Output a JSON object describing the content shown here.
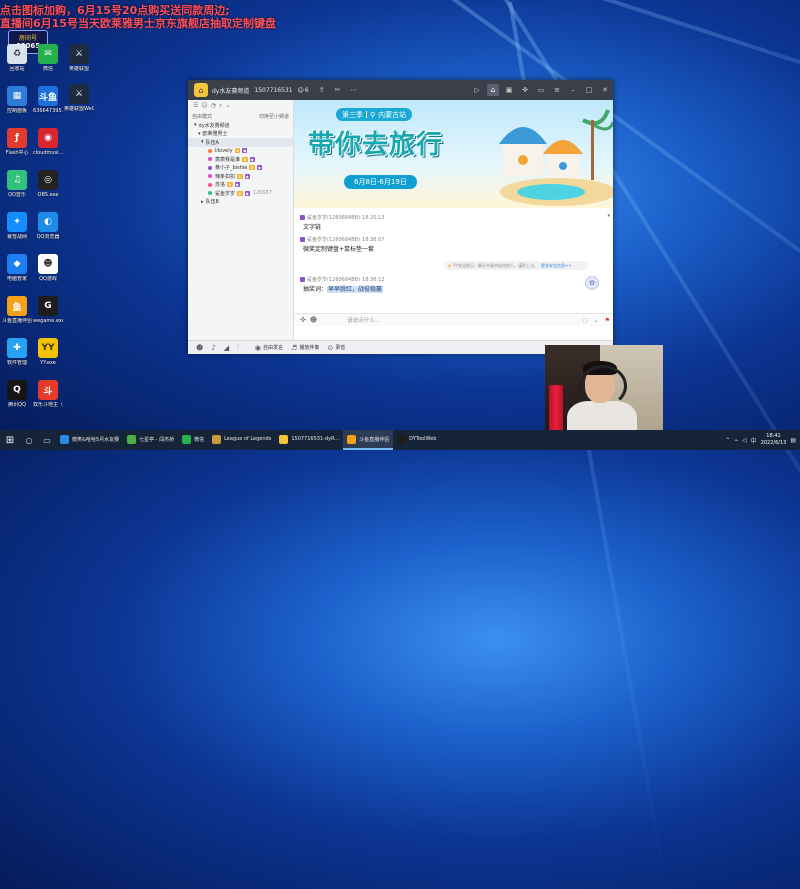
{
  "overlay": {
    "line1": "点击图标加购，6月15号20点购买送同款周边;",
    "line2": "直播间6月15号当天欧莱雅男士京东旗舰店抽取定制键盘",
    "brand_badge": "房间号",
    "room_no": "60065"
  },
  "desktop": {
    "col1": [
      {
        "label": "回收站",
        "color": "#d9e3ee",
        "glyph": "♻"
      },
      {
        "label": "控制面板",
        "color": "#2f7bd6",
        "glyph": "▦"
      },
      {
        "label": "Flash中心",
        "color": "#e23b2e",
        "glyph": "ƒ"
      },
      {
        "label": "QQ音乐",
        "color": "#31c27c",
        "glyph": "♫"
      },
      {
        "label": "暴雪战网",
        "color": "#148eff",
        "glyph": "✦"
      },
      {
        "label": "电脑管家",
        "color": "#1d7ff0",
        "glyph": "◆"
      },
      {
        "label": "斗鱼直播伴侣",
        "color": "#f4a118",
        "glyph": "鱼"
      },
      {
        "label": "软件管理",
        "color": "#26a3f2",
        "glyph": "✚"
      },
      {
        "label": "腾讯QQ",
        "color": "#151515",
        "glyph": "Q"
      }
    ],
    "col2": [
      {
        "label": "微信",
        "color": "#26b04e",
        "glyph": "✉"
      },
      {
        "label": "636647395...",
        "color": "#1e6fd9",
        "glyph": "斗鱼"
      },
      {
        "label": "cloudmusi...",
        "color": "#d8262f",
        "glyph": "◉"
      },
      {
        "label": "OBS.exe",
        "color": "#222222",
        "glyph": "◎"
      },
      {
        "label": "QQ浏览器",
        "color": "#1d8be8",
        "glyph": "◐"
      },
      {
        "label": "QQ游戏",
        "color": "#ffffff",
        "glyph": "☻"
      },
      {
        "label": "wegame.exe",
        "color": "#1d1d1d",
        "glyph": "G"
      },
      {
        "label": "YY.exe",
        "color": "#f5c400",
        "glyph": "YY"
      },
      {
        "label": "双乐斗地主（手游电脑版）",
        "color": "#e33c2c",
        "glyph": "斗"
      }
    ],
    "col3": [
      {
        "label": "英雄联盟",
        "color": "#1c2b3f",
        "glyph": "⚔"
      },
      {
        "label": "英雄联盟WeGame版",
        "color": "#1c2b3f",
        "glyph": "⚔"
      }
    ]
  },
  "window": {
    "title": "dy水友赛频道",
    "channel_id": "1507716531",
    "user_count": "6",
    "left_panel": {
      "mode_label": "自由模式",
      "switch_label": "切换至小频道",
      "channel": "dy水友赛频道",
      "group": "欧莱雅男士",
      "subgroup": "队伍A",
      "members": [
        {
          "name": "lilovely",
          "color": "#ff7c2a"
        },
        {
          "name": "萧萧我是谁",
          "color": "#d94fc0"
        },
        {
          "name": "黄小子_bishie",
          "color": "#8a53c6"
        },
        {
          "name": "辣条扣扣",
          "color": "#d94fc0"
        },
        {
          "name": "苏洛",
          "color": "#ff4c8c"
        },
        {
          "name": "鲨鱼岁岁",
          "color": "#2ac07a",
          "extra": "126687"
        }
      ],
      "other_group": "队伍B"
    },
    "banner": {
      "season": "第三季",
      "location": "内蒙古站",
      "title": "带你去旅行",
      "dates": "6月8日-6月19日"
    },
    "messages": [
      {
        "user": "鲨鱼岁岁(1260684BB)",
        "time": "18:20:13",
        "text": "文字链"
      },
      {
        "user": "鲨鱼岁岁(1260684BB)",
        "time": "18:36:07",
        "text": "微笑定制键盘+鼠标垫一套"
      },
      {
        "user": "鲨鱼岁岁(1260684BB)",
        "time": "18:36:12",
        "text": "抽奖词：",
        "highlight": "早早脱红，战役稳赢"
      }
    ],
    "notice": {
      "text": "YY安全提示：聊天中请勿轻信他人，谨防上当。",
      "link": "更多安全信息>>"
    },
    "input_placeholder": "请说点什么...",
    "bottom_bar": [
      {
        "icon": "smile-icon",
        "glyph": "☻",
        "label": ""
      },
      {
        "icon": "mic-icon",
        "glyph": "♪",
        "label": ""
      },
      {
        "icon": "speaker-icon",
        "glyph": "◢",
        "label": ""
      },
      {
        "icon": "settings-icon",
        "glyph": "⫶",
        "label": ""
      },
      {
        "icon": "free-talk-icon",
        "glyph": "◉",
        "label": "自由发言"
      },
      {
        "icon": "music-icon",
        "glyph": "♬",
        "label": "播放伴奏"
      },
      {
        "icon": "record-icon",
        "glyph": "⊙",
        "label": "录音"
      }
    ]
  },
  "taskbar": {
    "tasks": [
      {
        "label": "微笑&哈哈5月水友赛",
        "color": "#2c8be6"
      },
      {
        "label": "七星亭 - 闯杰桥",
        "color": "#4ab040"
      },
      {
        "label": "微信",
        "color": "#26b04e"
      },
      {
        "label": "League of Legends",
        "color": "#c89b3c"
      },
      {
        "label": "1507716531-dyR...",
        "color": "#f3c43c"
      },
      {
        "label": "斗鱼直播伴侣",
        "color": "#f4a118",
        "active": true
      },
      {
        "label": "DYToolWeb",
        "color": "#1d1d1d"
      }
    ],
    "time": "18:41",
    "date": "2022/6/13"
  }
}
